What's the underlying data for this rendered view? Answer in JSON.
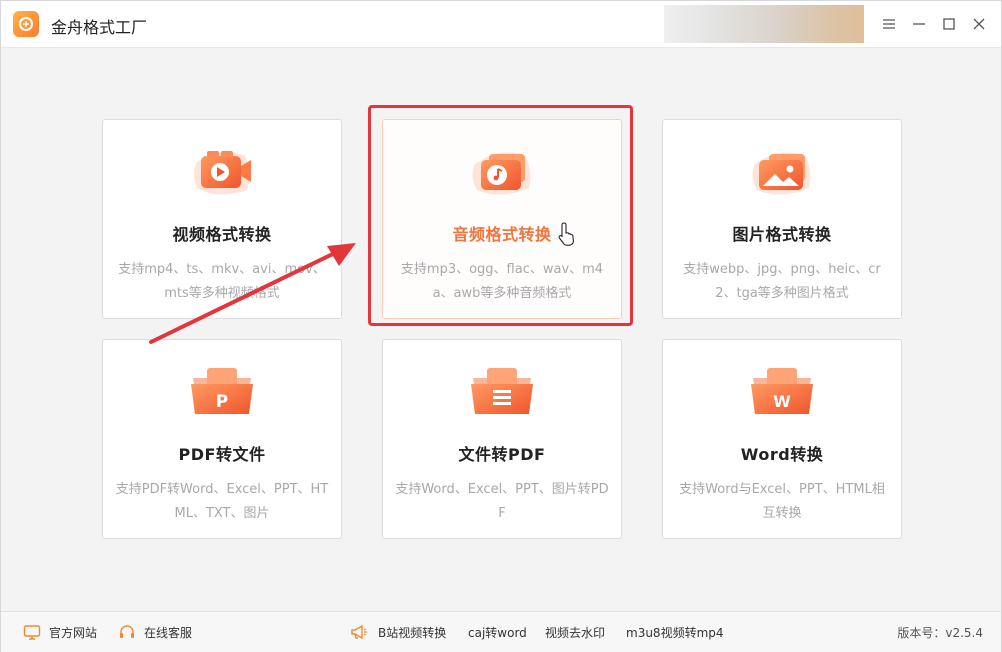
{
  "app": {
    "title": "金舟格式工厂"
  },
  "cards": [
    {
      "title": "视频格式转换",
      "desc": "支持mp4、ts、mkv、avi、mov、mts等多种视频格式",
      "icon": "video-format-icon"
    },
    {
      "title": "音频格式转换",
      "desc": "支持mp3、ogg、flac、wav、m4a、awb等多种音频格式",
      "icon": "audio-format-icon"
    },
    {
      "title": "图片格式转换",
      "desc": "支持webp、jpg、png、heic、cr2、tga等多种图片格式",
      "icon": "image-format-icon"
    },
    {
      "title": "PDF转文件",
      "desc": "支持PDF转Word、Excel、PPT、HTML、TXT、图片",
      "icon": "pdf-icon"
    },
    {
      "title": "文件转PDF",
      "desc": "支持Word、Excel、PPT、图片转PDF",
      "icon": "document-icon"
    },
    {
      "title": "Word转换",
      "desc": "支持Word与Excel、PPT、HTML相互转换",
      "icon": "word-icon"
    }
  ],
  "footer": {
    "website": "官方网站",
    "support": "在线客服",
    "promo_links": [
      "B站视频转换",
      "caj转word",
      "视频去水印",
      "m3u8视频转mp4"
    ],
    "version": "版本号：v2.5.4"
  },
  "colors": {
    "accent": "#f3743e",
    "highlight": "#e2363b",
    "icon_gradient_start": "#ff9a62",
    "icon_gradient_end": "#f0552c"
  }
}
